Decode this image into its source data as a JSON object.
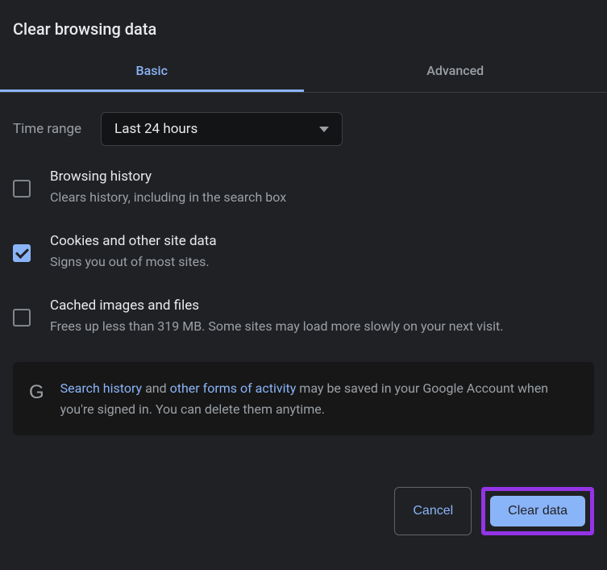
{
  "title": "Clear browsing data",
  "tabs": {
    "basic": "Basic",
    "advanced": "Advanced"
  },
  "time": {
    "label": "Time range",
    "value": "Last 24 hours"
  },
  "items": [
    {
      "title": "Browsing history",
      "desc": "Clears history, including in the search box",
      "checked": false
    },
    {
      "title": "Cookies and other site data",
      "desc": "Signs you out of most sites.",
      "checked": true
    },
    {
      "title": "Cached images and files",
      "desc": "Frees up less than 319 MB. Some sites may load more slowly on your next visit.",
      "checked": false
    }
  ],
  "notice": {
    "link1": "Search history",
    "mid1": " and ",
    "link2": "other forms of activity",
    "rest": " may be saved in your Google Account when you're signed in. You can delete them anytime."
  },
  "actions": {
    "cancel": "Cancel",
    "clear": "Clear data"
  }
}
